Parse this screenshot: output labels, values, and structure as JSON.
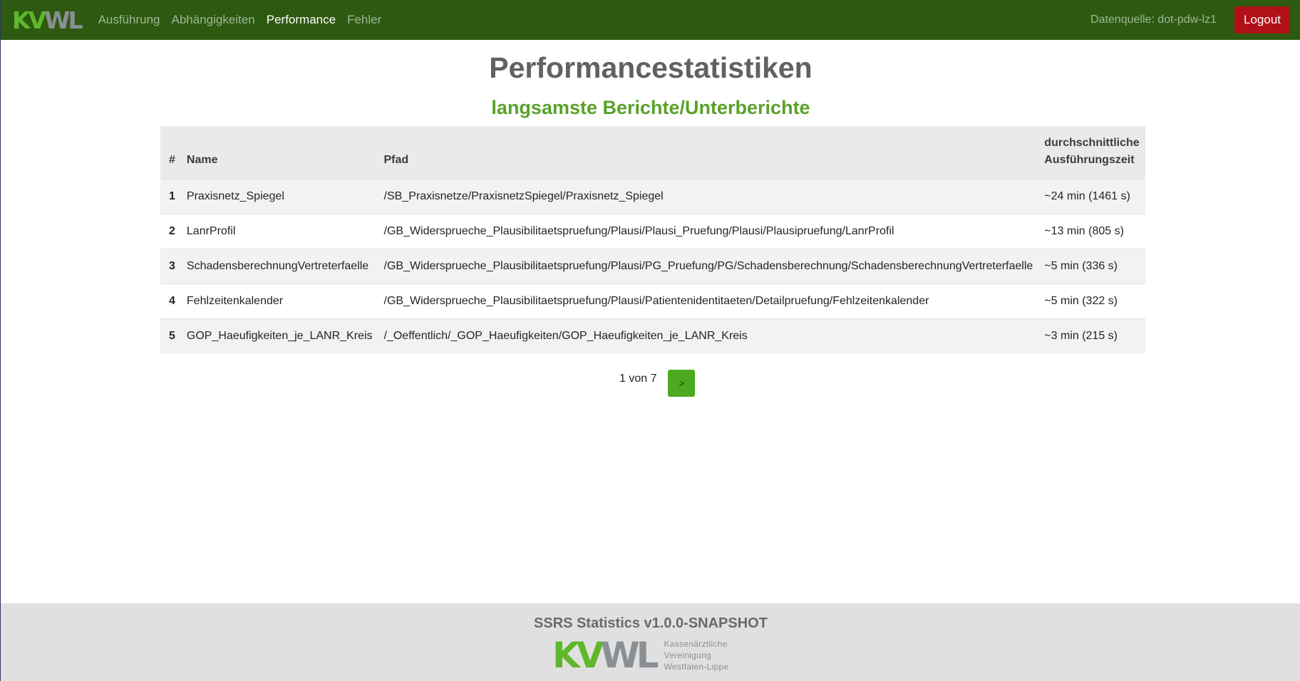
{
  "brand": {
    "kv": "KV",
    "wl": "WL"
  },
  "nav": {
    "items": [
      {
        "label": "Ausführung",
        "active": false
      },
      {
        "label": "Abhängigkeiten",
        "active": false
      },
      {
        "label": "Performance",
        "active": true
      },
      {
        "label": "Fehler",
        "active": false
      }
    ],
    "datasource": "Datenquelle: dot-pdw-lz1",
    "logout_label": "Logout"
  },
  "main": {
    "title": "Performancestatistiken",
    "subtitle": "langsamste Berichte/Unterberichte"
  },
  "table": {
    "headers": {
      "num": "#",
      "name": "Name",
      "path": "Pfad",
      "time_line1": "durchschnittliche",
      "time_line2": "Ausführungszeit"
    },
    "rows": [
      {
        "num": "1",
        "name": "Praxisnetz_Spiegel",
        "path": "/SB_Praxisnetze/PraxisnetzSpiegel/Praxisnetz_Spiegel",
        "time": "~24 min (1461 s)"
      },
      {
        "num": "2",
        "name": "LanrProfil",
        "path": "/GB_Widersprueche_Plausibilitaetspruefung/Plausi/Plausi_Pruefung/Plausi/Plausipruefung/LanrProfil",
        "time": "~13 min (805 s)"
      },
      {
        "num": "3",
        "name": "SchadensberechnungVertreterfaelle",
        "path": "/GB_Widersprueche_Plausibilitaetspruefung/Plausi/PG_Pruefung/PG/Schadensberechnung/SchadensberechnungVertreterfaelle",
        "time": "~5 min (336 s)"
      },
      {
        "num": "4",
        "name": "Fehlzeitenkalender",
        "path": "/GB_Widersprueche_Plausibilitaetspruefung/Plausi/Patientenidentitaeten/Detailpruefung/Fehlzeitenkalender",
        "time": "~5 min (322 s)"
      },
      {
        "num": "5",
        "name": "GOP_Haeufigkeiten_je_LANR_Kreis",
        "path": "/_Oeffentlich/_GOP_Haeufigkeiten/GOP_Haeufigkeiten_je_LANR_Kreis",
        "time": "~3 min (215 s)"
      }
    ]
  },
  "pagination": {
    "info": "1 von 7",
    "next_label": ">"
  },
  "footer": {
    "title": "SSRS Statistics v1.0.0-SNAPSHOT",
    "logo_kv": "KV",
    "logo_wl": "WL",
    "org_line1": "Kassenärztliche",
    "org_line2": "Vereinigung",
    "org_line3": "Westfalen-Lippe"
  },
  "colors": {
    "navbar": "#2d5a10",
    "accent_green": "#5aa12a",
    "logout": "#b01018",
    "footer": "#e0e0e0"
  }
}
